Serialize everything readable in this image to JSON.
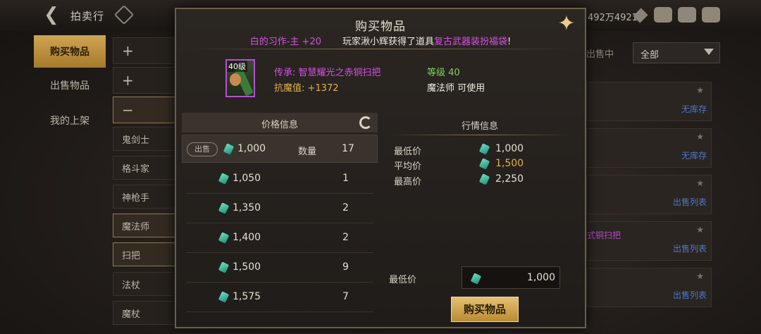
{
  "app": {
    "title": "拍卖行",
    "currency": "492万4921"
  },
  "sidebar": {
    "tabs": [
      {
        "label": "购买物品"
      },
      {
        "label": "出售物品"
      },
      {
        "label": "我的上架"
      }
    ]
  },
  "categories": {
    "items": [
      "+",
      "+",
      "−",
      "鬼剑士",
      "格斗家",
      "神枪手",
      "魔法师",
      "扫把",
      "法杖",
      "魔杖"
    ]
  },
  "filter": {
    "label": "出售中",
    "selected": "全部"
  },
  "listings": [
    {
      "status": "无库存"
    },
    {
      "status": "无库存"
    },
    {
      "status": "出售列表"
    },
    {
      "name": "式铜扫把",
      "status": "出售列表"
    },
    {
      "status": "出售列表"
    }
  ],
  "modal": {
    "title": "购买物品",
    "notice": {
      "prefix": "白的习作-主 +20",
      "text": "玩家湫小辉获得了道具",
      "highlight": "复古武器装扮福袋",
      "suffix": "!"
    },
    "item": {
      "level_badge": "40级",
      "name": "传承: 智慧耀光之赤铜扫把",
      "stat": "抗魔值: +1372",
      "level_req": "等级 40",
      "class_req": "魔法师 可使用"
    },
    "price_info": {
      "header": "价格信息",
      "first": {
        "badge": "出售",
        "price": "1,000",
        "qty_label": "数量",
        "qty": "17"
      },
      "rows": [
        {
          "price": "1,050",
          "qty": "1"
        },
        {
          "price": "1,350",
          "qty": "2"
        },
        {
          "price": "1,400",
          "qty": "2"
        },
        {
          "price": "1,500",
          "qty": "9"
        },
        {
          "price": "1,575",
          "qty": "7"
        }
      ]
    },
    "market": {
      "title": "行情信息",
      "min_label": "最低价",
      "min_value": "1,000",
      "avg_label": "平均价",
      "avg_value": "1,500",
      "max_label": "最高价",
      "max_value": "2,250"
    },
    "purchase": {
      "min_label": "最低价",
      "min_value": "1,000",
      "button": "购买物品"
    }
  }
}
